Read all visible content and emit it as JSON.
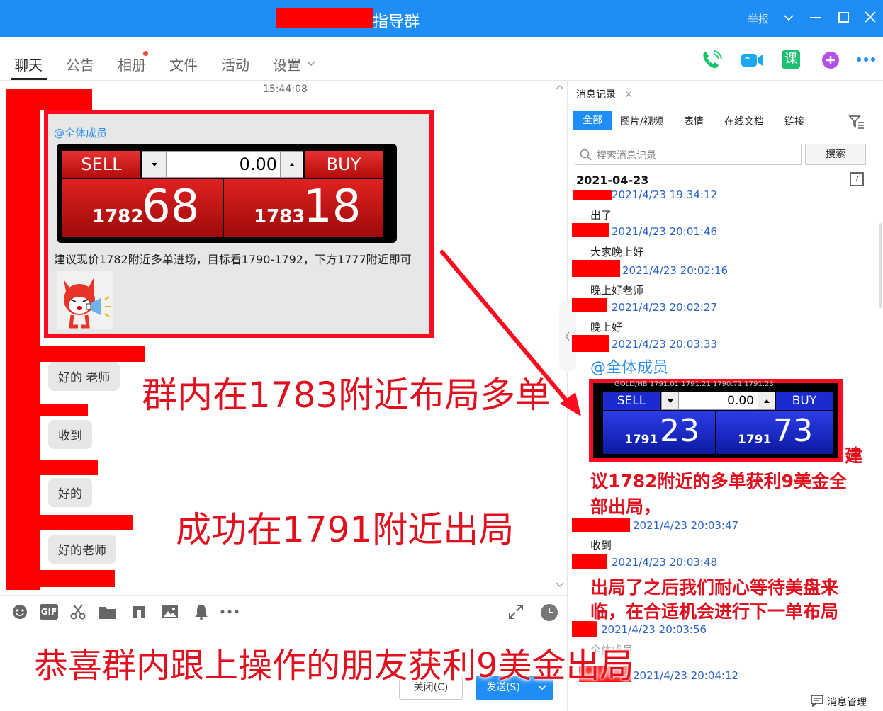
{
  "window": {
    "title": "指导群",
    "report_label": "举报"
  },
  "tabs": [
    {
      "label": "聊天"
    },
    {
      "label": "公告"
    },
    {
      "label": "相册"
    },
    {
      "label": "文件"
    },
    {
      "label": "活动"
    },
    {
      "label": "设置"
    }
  ],
  "header_icons": {
    "course_label": "课"
  },
  "chat": {
    "timestamp": "15:44:08",
    "mention": "@全体成员",
    "trade_widget": {
      "sell_label": "SELL",
      "buy_label": "BUY",
      "qty": "0.00",
      "sell_prefix": "1782",
      "sell_big": "68",
      "buy_prefix": "1783",
      "buy_big": "18"
    },
    "advice_text": "建议现价1782附近多单进场，目标看1790-1792，下方1777附近即可",
    "replies": [
      {
        "text": "好的 老师"
      },
      {
        "text": "收到"
      },
      {
        "text": "好的"
      },
      {
        "text": "好的老师"
      }
    ]
  },
  "toolbar": {
    "gif_label": "GIF",
    "close_button": "关闭(C)",
    "send_button": "发送(S)"
  },
  "side": {
    "tab_title": "消息记录",
    "filters": [
      {
        "label": "全部"
      },
      {
        "label": "图片/视频"
      },
      {
        "label": "表情"
      },
      {
        "label": "在线文档"
      },
      {
        "label": "链接"
      }
    ],
    "search_placeholder": "搜索消息记录",
    "search_button": "搜索",
    "date": "2021-04-23",
    "calendar_day": "7",
    "messages": [
      {
        "time": "2021/4/23 19:34:12",
        "text": "出了"
      },
      {
        "time": "2021/4/23 20:01:46",
        "text": "大家晚上好"
      },
      {
        "time": "2021/4/23 20:02:16",
        "text": "晚上好老师"
      },
      {
        "time": "2021/4/23 20:02:27",
        "text": "晚上好"
      },
      {
        "time": "2021/4/23 20:03:33",
        "text": "@全体成员"
      },
      {
        "time": "2021/4/23 20:03:47",
        "text": "收到"
      },
      {
        "time": "2021/4/23 20:03:48",
        "text": ""
      },
      {
        "time": "2021/4/23 20:03:56",
        "text": "全体成员"
      },
      {
        "time": "2021/4/23 20:04:12",
        "text": ""
      }
    ],
    "trade_widget": {
      "header": "GOLD/HB 1791.01 1791.21 1790.71 1791.23",
      "sell_label": "SELL",
      "buy_label": "BUY",
      "qty": "0.00",
      "sell_prefix": "1791",
      "sell_big": "23",
      "buy_prefix": "1791",
      "buy_big": "73"
    },
    "manage_label": "消息管理"
  },
  "annotations": {
    "a1": "群内在1783附近布局多单",
    "a2": "成功在1791附近出局",
    "a3": "恭喜群内跟上操作的朋友获利9美金出局",
    "side_note1_l1": "建",
    "side_note1_l2": "议1782附近的多单获利9美金全",
    "side_note1_l3": "部出局，",
    "side_note2_l1": "出局了之后我们耐心等待美盘来",
    "side_note2_l2": "临，在合适机会进行下一单布局"
  },
  "colors": {
    "titlebar": "#1e8df5",
    "accent": "#1e8df5",
    "annotation_red": "#e0101e",
    "redaction": "#ff0000"
  }
}
